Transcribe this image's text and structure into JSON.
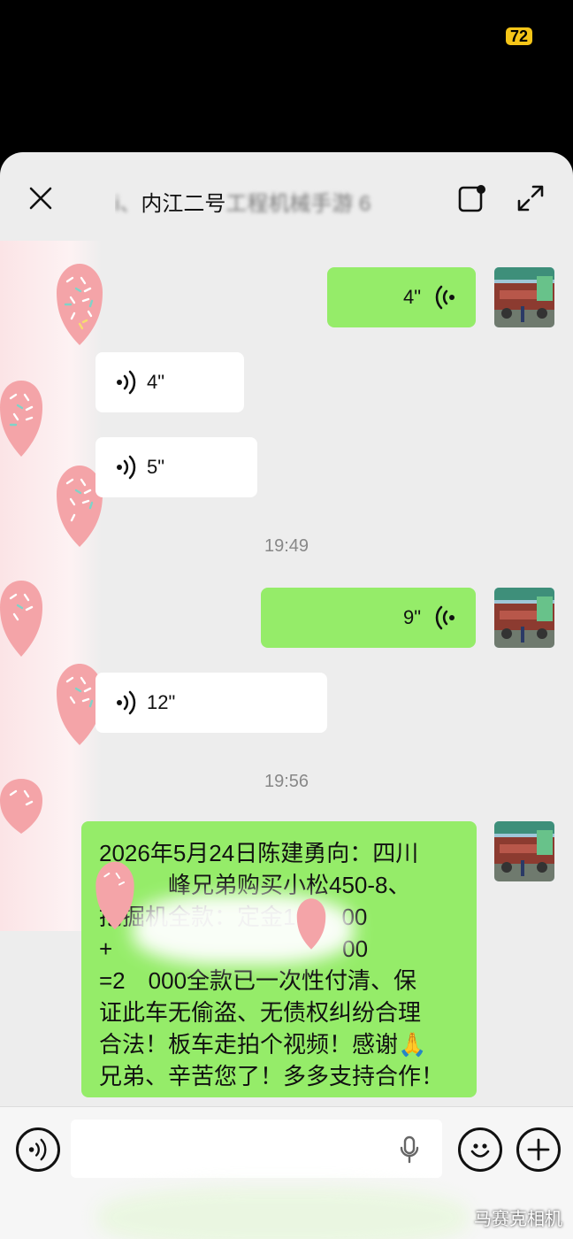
{
  "status": {
    "battery": "72"
  },
  "header": {
    "title_prefix": "i、",
    "title_main": "内江二号",
    "title_tail": "工程机械手游 6"
  },
  "messages": {
    "m1": {
      "side": "right",
      "duration": "4\""
    },
    "m2": {
      "side": "left",
      "duration": "4\""
    },
    "m3": {
      "side": "left",
      "duration": "5\""
    },
    "t1": "19:49",
    "m4": {
      "side": "right",
      "duration": "9\""
    },
    "m5": {
      "side": "left",
      "duration": "12\""
    },
    "t2": "19:56",
    "m6": {
      "side": "right",
      "lines": [
        "2026年5月24日陈建勇向：四川",
        "　　　峰兄弟购买小松450-8、",
        "挖掘机全款：定金1　　00",
        "+　　　　　　　　　　00",
        "=2　000全款已一次性付清、保",
        "证此车无偷盗、无债权纠纷合理",
        "合法！板车走拍个视频！感谢🙏",
        "兄弟、辛苦您了！多多支持合作！"
      ]
    }
  },
  "icons": {
    "close": "close-icon",
    "note": "note-icon",
    "expand": "expand-icon",
    "voice": "voice-icon",
    "mic": "microphone-icon",
    "emoji": "emoji-icon",
    "plus": "plus-icon"
  },
  "colors": {
    "green_bubble": "#95ec69",
    "background": "#ededed",
    "battery": "#f5c518"
  },
  "watermark": "马赛克相机"
}
